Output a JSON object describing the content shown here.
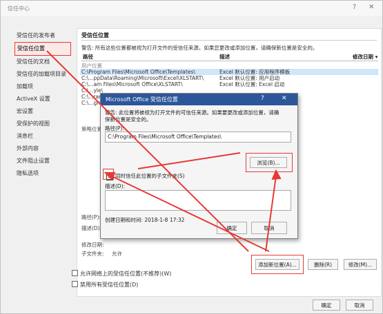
{
  "window": {
    "title": "信任中心",
    "help": "?",
    "close": "✕"
  },
  "sidebar": {
    "items": [
      {
        "label": "受信任的发布者"
      },
      {
        "label": "受信任位置",
        "selected": true
      },
      {
        "label": "受信任的文档"
      },
      {
        "label": "受信任的加载项目录"
      },
      {
        "label": "加载项"
      },
      {
        "label": "ActiveX 设置"
      },
      {
        "label": "宏设置"
      },
      {
        "label": "受保护的视图"
      },
      {
        "label": "消息栏"
      },
      {
        "label": "外部内容"
      },
      {
        "label": "文件阻止设置"
      },
      {
        "label": "隐私选项"
      }
    ]
  },
  "main": {
    "section_title": "受信任位置",
    "warning": "警告: 所有这些位置都被视为打开文件的受信任来源。如果您更改或添加位置，请确保新位置是安全的。",
    "columns": {
      "path": "路径",
      "desc": "描述",
      "date": "修改日期 ▾"
    },
    "user_locations_label": "用户位置",
    "rows": [
      {
        "path": "C:\\Program Files\\Microsoft Office\\Templates\\",
        "desc": "Excel 默认位置: 应用程序模板"
      },
      {
        "path": "C:\\...ppData\\Roaming\\Microsoft\\Excel\\XLSTART\\",
        "desc": "Excel 默认位置: 用户启动"
      },
      {
        "path": "C:\\...am Files\\Microsoft Office\\XLSTART\\",
        "desc": "Excel 默认位置: Excel 启动"
      },
      {
        "path": "C:\\...yle\\",
        "desc": ""
      },
      {
        "path": "C:\\...ram",
        "desc": ""
      },
      {
        "path": "C:\\...grai",
        "desc": ""
      }
    ],
    "policy_label": "策略位置",
    "detail_path_label": "路径(P):",
    "detail_desc_label": "描述(D)",
    "modified_label": "修改日期:",
    "subfolders_label": "子文件夹:",
    "subfolders_value": "允许",
    "add_button": "添加新位置(A)...",
    "remove_button": "删除(R)",
    "modify_button": "修改(M)...",
    "allow_network": "允许网络上的受信任位置(不推荐)(W)",
    "disable_all": "禁用所有受信任位置(D)"
  },
  "dialog": {
    "title": "Microsoft Office 受信任位置",
    "help": "?",
    "close": "✕",
    "warning_line1": "警告: 此位置将被视为打开文件的可信任来源。如果要更改或添加位置，请确",
    "warning_line2": "保新位置是安全的。",
    "path_label": "路径(P):",
    "path_value": "C:\\Program Files\\Microsoft Office\\Templates\\",
    "browse_button": "浏览(B)...",
    "subfolder_checkbox": "同时信任此位置的子文件夹(S)",
    "subfolder_checked": true,
    "desc_label": "描述(D):",
    "created_label": "创建日期和时间: 2018-1-8 17:32",
    "ok_button": "确定",
    "cancel_button": "取消"
  },
  "footer": {
    "ok_button": "确定",
    "cancel_button": "取消"
  },
  "colors": {
    "highlight": "#e53935",
    "dialog_title": "#2b579a",
    "selection": "#cfe6fb"
  }
}
